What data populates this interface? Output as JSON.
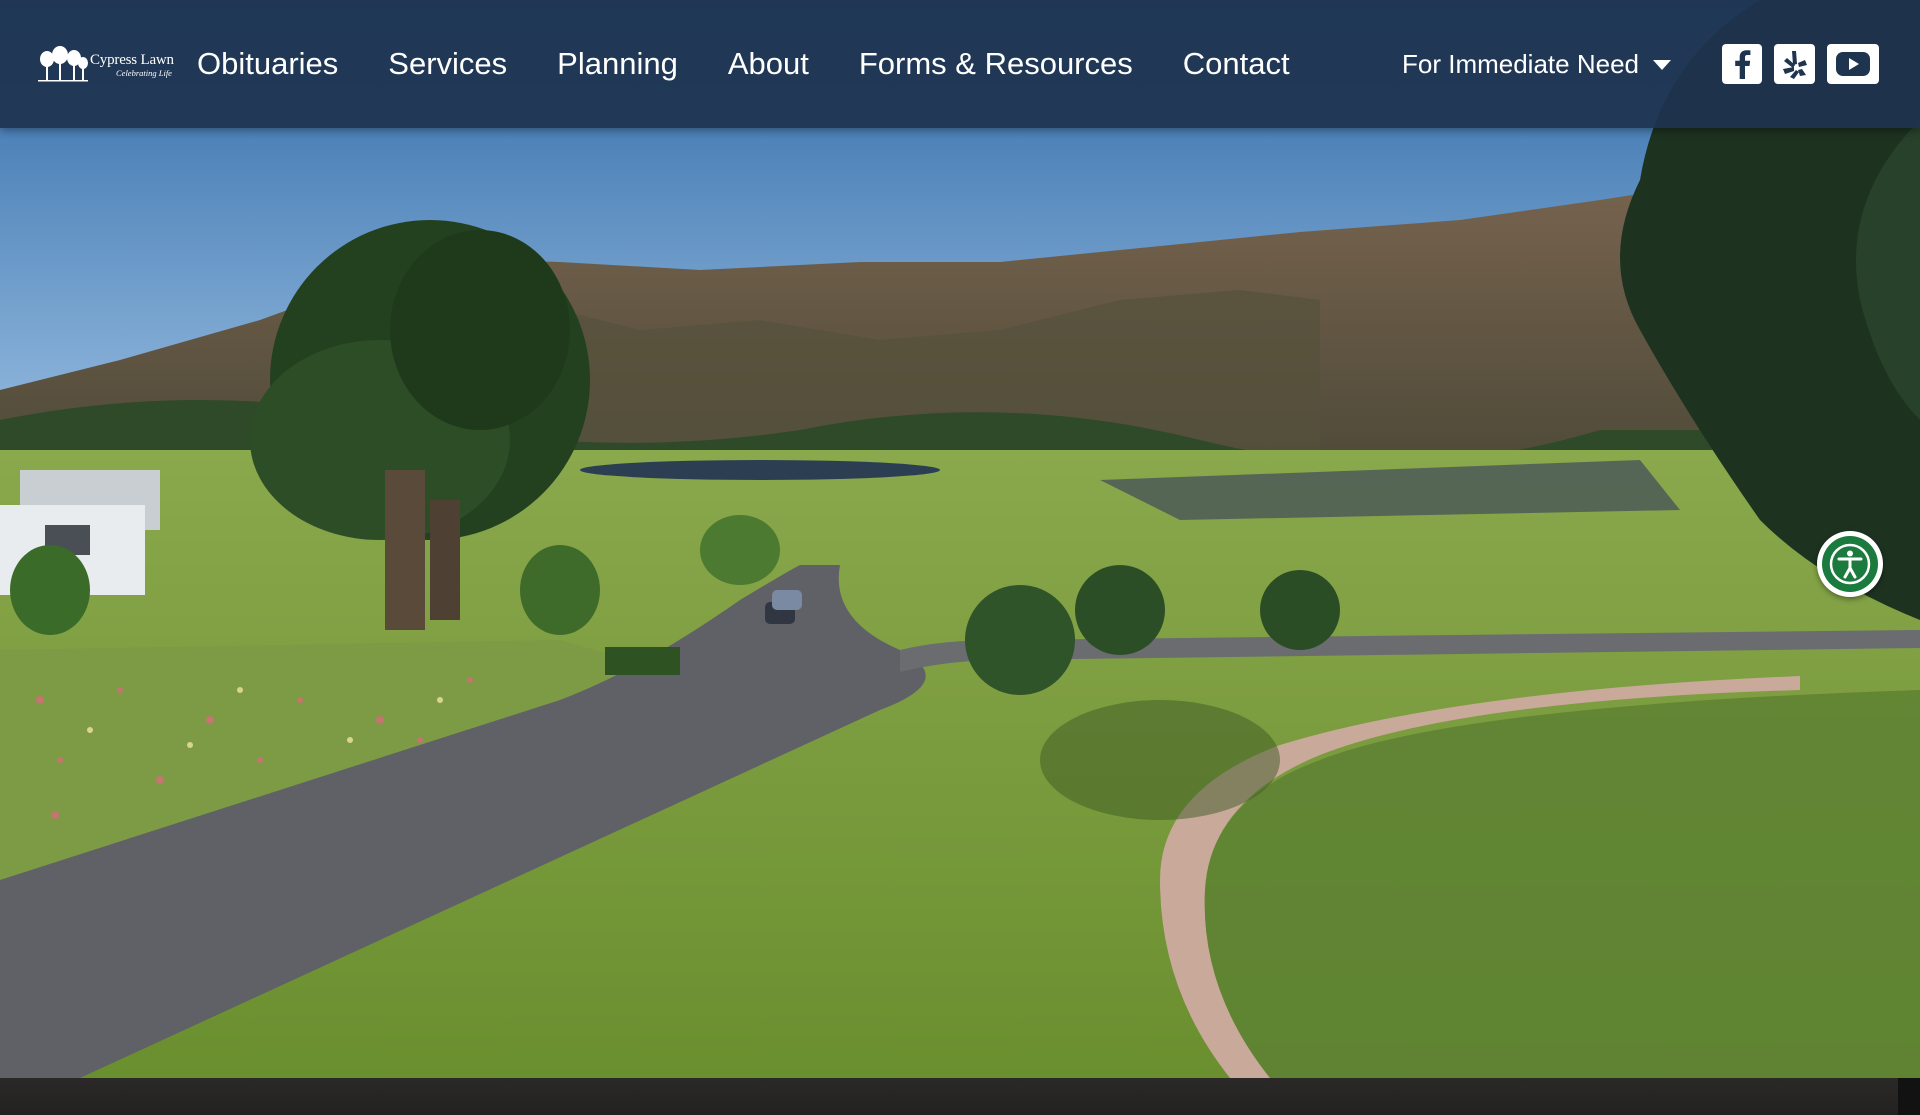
{
  "logo": {
    "name": "Cypress Lawn",
    "tagline": "Celebrating Life"
  },
  "nav": {
    "items": [
      {
        "label": "Obituaries"
      },
      {
        "label": "Services"
      },
      {
        "label": "Planning"
      },
      {
        "label": "About"
      },
      {
        "label": "Forms & Resources"
      },
      {
        "label": "Contact"
      }
    ]
  },
  "immediate_need": {
    "label": "For Immediate Need"
  },
  "social": {
    "icons": [
      "facebook-icon",
      "yelp-icon",
      "youtube-icon"
    ]
  },
  "accessibility": {
    "icon": "accessibility-icon",
    "color": "#1b7a3d"
  },
  "colors": {
    "header": "#1e344f",
    "grass": "#7da03c",
    "sky": "#4f86c4",
    "road": "#5f6166"
  }
}
